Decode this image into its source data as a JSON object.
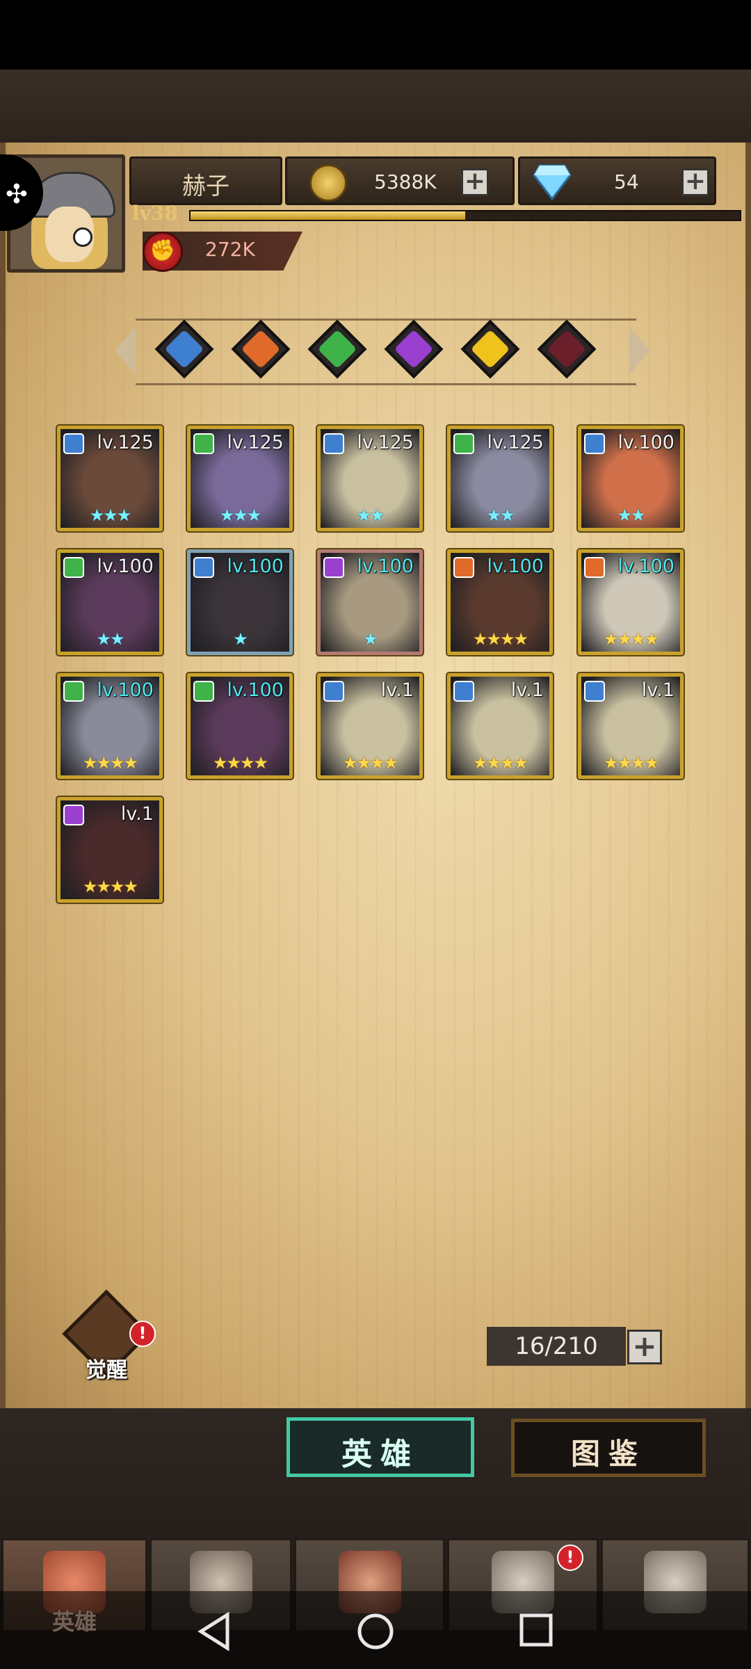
{
  "player": {
    "name": "赫子",
    "level": "lv38",
    "gold": "5388K",
    "gems": "54",
    "power": "272K",
    "xp_progress": 0.5
  },
  "filters": [
    {
      "name": "class-filter-blue",
      "color": "#3f7fd0"
    },
    {
      "name": "class-filter-orange",
      "color": "#e06a2a"
    },
    {
      "name": "class-filter-green",
      "color": "#3fb34a"
    },
    {
      "name": "class-filter-purple",
      "color": "#9a3fd0"
    },
    {
      "name": "class-filter-yellow",
      "color": "#f0c21c"
    },
    {
      "name": "class-filter-darkred",
      "color": "#6a1f2a"
    }
  ],
  "heroes": [
    {
      "level": "lv.125",
      "stars": "★★★",
      "star_color": "cyan",
      "class_color": "#3f7fd0",
      "frame": "gold",
      "lv_color": "white",
      "tone": "#6b4a3a"
    },
    {
      "level": "lv.125",
      "stars": "★★★",
      "star_color": "cyan",
      "class_color": "#3fb34a",
      "frame": "gold",
      "lv_color": "white",
      "tone": "#7a6a9a"
    },
    {
      "level": "lv.125",
      "stars": "★★",
      "star_color": "cyan",
      "class_color": "#3f7fd0",
      "frame": "gold",
      "lv_color": "white",
      "tone": "#c9c0a0"
    },
    {
      "level": "lv.125",
      "stars": "★★",
      "star_color": "cyan",
      "class_color": "#3fb34a",
      "frame": "gold",
      "lv_color": "white",
      "tone": "#8a8aa0"
    },
    {
      "level": "lv.100",
      "stars": "★★",
      "star_color": "cyan",
      "class_color": "#3f7fd0",
      "frame": "gold",
      "lv_color": "white",
      "tone": "#d0704a"
    },
    {
      "level": "lv.100",
      "stars": "★★",
      "star_color": "cyan",
      "class_color": "#3fb34a",
      "frame": "gold",
      "lv_color": "white",
      "tone": "#5a3a5a"
    },
    {
      "level": "lv.100",
      "stars": "★",
      "star_color": "cyan",
      "class_color": "#3f7fd0",
      "frame": "blue",
      "lv_color": "cyan",
      "tone": "#3a3438"
    },
    {
      "level": "lv.100",
      "stars": "★",
      "star_color": "cyan",
      "class_color": "#9a3fd0",
      "frame": "pink",
      "lv_color": "cyan",
      "tone": "#a89a80"
    },
    {
      "level": "lv.100",
      "stars": "★★★★",
      "star_color": "gold",
      "class_color": "#e06a2a",
      "frame": "gold",
      "lv_color": "cyan",
      "tone": "#5a3a2e"
    },
    {
      "level": "lv.100",
      "stars": "★★★★",
      "star_color": "gold",
      "class_color": "#e06a2a",
      "frame": "gold",
      "lv_color": "cyan",
      "tone": "#cfc8b8"
    },
    {
      "level": "lv.100",
      "stars": "★★★★",
      "star_color": "gold",
      "class_color": "#3fb34a",
      "frame": "gold",
      "lv_color": "cyan",
      "tone": "#8a8a9a"
    },
    {
      "level": "lv.100",
      "stars": "★★★★",
      "star_color": "gold",
      "class_color": "#3fb34a",
      "frame": "gold",
      "lv_color": "cyan",
      "tone": "#5a3a5a"
    },
    {
      "level": "lv.1",
      "stars": "★★★★",
      "star_color": "gold",
      "class_color": "#3f7fd0",
      "frame": "gold",
      "lv_color": "white",
      "tone": "#c9c0a0"
    },
    {
      "level": "lv.1",
      "stars": "★★★★",
      "star_color": "gold",
      "class_color": "#3f7fd0",
      "frame": "gold",
      "lv_color": "white",
      "tone": "#c9c0a0"
    },
    {
      "level": "lv.1",
      "stars": "★★★★",
      "star_color": "gold",
      "class_color": "#3f7fd0",
      "frame": "gold",
      "lv_color": "white",
      "tone": "#c9c0a0"
    },
    {
      "level": "lv.1",
      "stars": "★★★★",
      "star_color": "gold",
      "class_color": "#9a3fd0",
      "frame": "gold",
      "lv_color": "white",
      "tone": "#4a2a2a"
    }
  ],
  "awaken": {
    "label": "觉醒",
    "badge": "!"
  },
  "capacity": "16/210",
  "tabs": {
    "heroes": "英雄",
    "codex": "图鉴"
  },
  "nav": {
    "heroes_label": "英雄",
    "quest_badge": "!"
  },
  "icons": {
    "plus": "+",
    "back": "back-triangle-icon",
    "home": "home-circle-icon",
    "recents": "recents-square-icon"
  }
}
